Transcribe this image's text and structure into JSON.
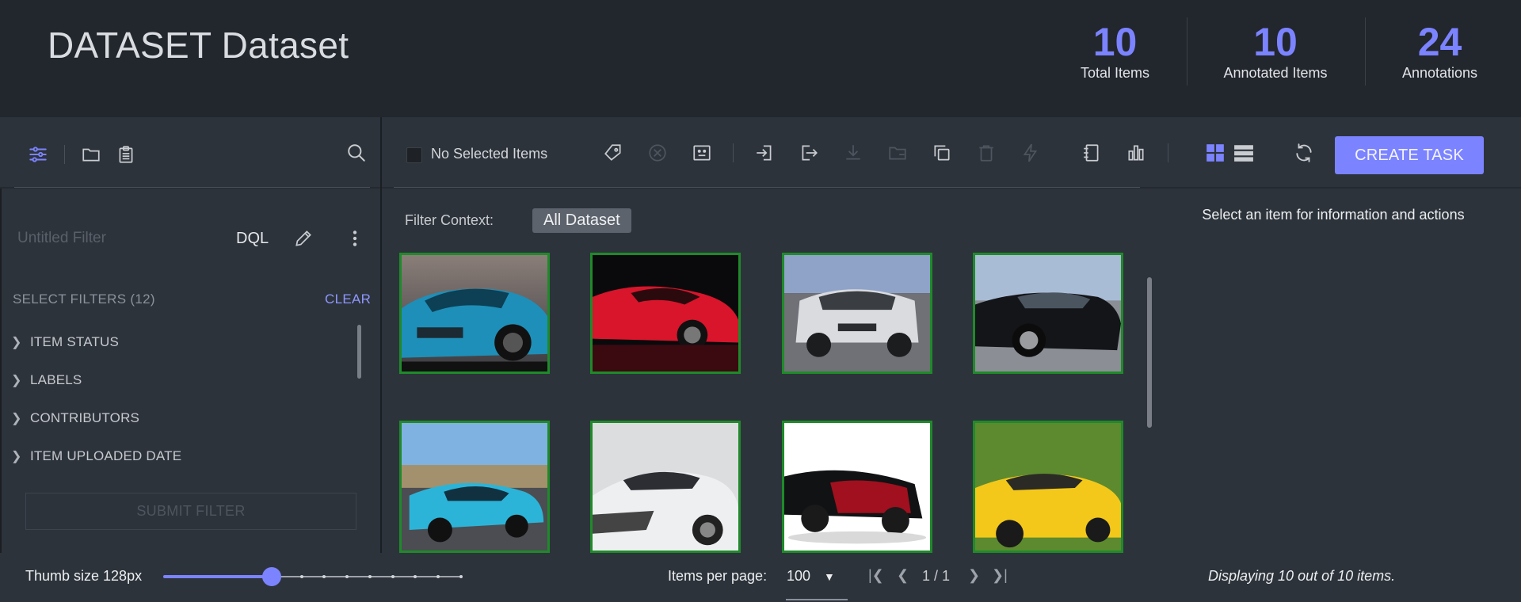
{
  "header": {
    "title": "DATASET Dataset",
    "stats": [
      {
        "value": "10",
        "label": "Total Items"
      },
      {
        "value": "10",
        "label": "Annotated Items"
      },
      {
        "value": "24",
        "label": "Annotations"
      }
    ]
  },
  "filter_panel": {
    "filter_name_placeholder": "Untitled Filter",
    "dql_label": "DQL",
    "select_filters_label": "SELECT FILTERS (12)",
    "clear_label": "CLEAR",
    "filter_groups": [
      "ITEM STATUS",
      "LABELS",
      "CONTRIBUTORS",
      "ITEM UPLOADED DATE"
    ],
    "submit_label": "SUBMIT FILTER"
  },
  "toolbar": {
    "selection_label": "No Selected Items",
    "create_task_label": "CREATE TASK",
    "view_mode": "grid"
  },
  "gallery": {
    "filter_context_label": "Filter Context:",
    "filter_context_value": "All Dataset",
    "items": [
      {
        "subject": "blue sports car rear view"
      },
      {
        "subject": "red sports car"
      },
      {
        "subject": "silver SUV on road"
      },
      {
        "subject": "black muscle car"
      },
      {
        "subject": "light blue sports car on road"
      },
      {
        "subject": "white hypercar"
      },
      {
        "subject": "red and black hypercar"
      },
      {
        "subject": "yellow convertible supercar"
      }
    ]
  },
  "details_panel": {
    "message": "Select an item for information and actions"
  },
  "footer": {
    "thumb_size_label": "Thumb size 128px",
    "thumb_size_level_fraction": 0.36,
    "items_per_page_label": "Items per page:",
    "items_per_page_value": "100",
    "page_indicator": "1 / 1",
    "displaying_text": "Displaying 10 out of 10 items."
  },
  "colors": {
    "accent": "#7b83ff",
    "thumb_border": "#1f8a2a",
    "background": "#252a31",
    "panel": "#2d333b"
  }
}
